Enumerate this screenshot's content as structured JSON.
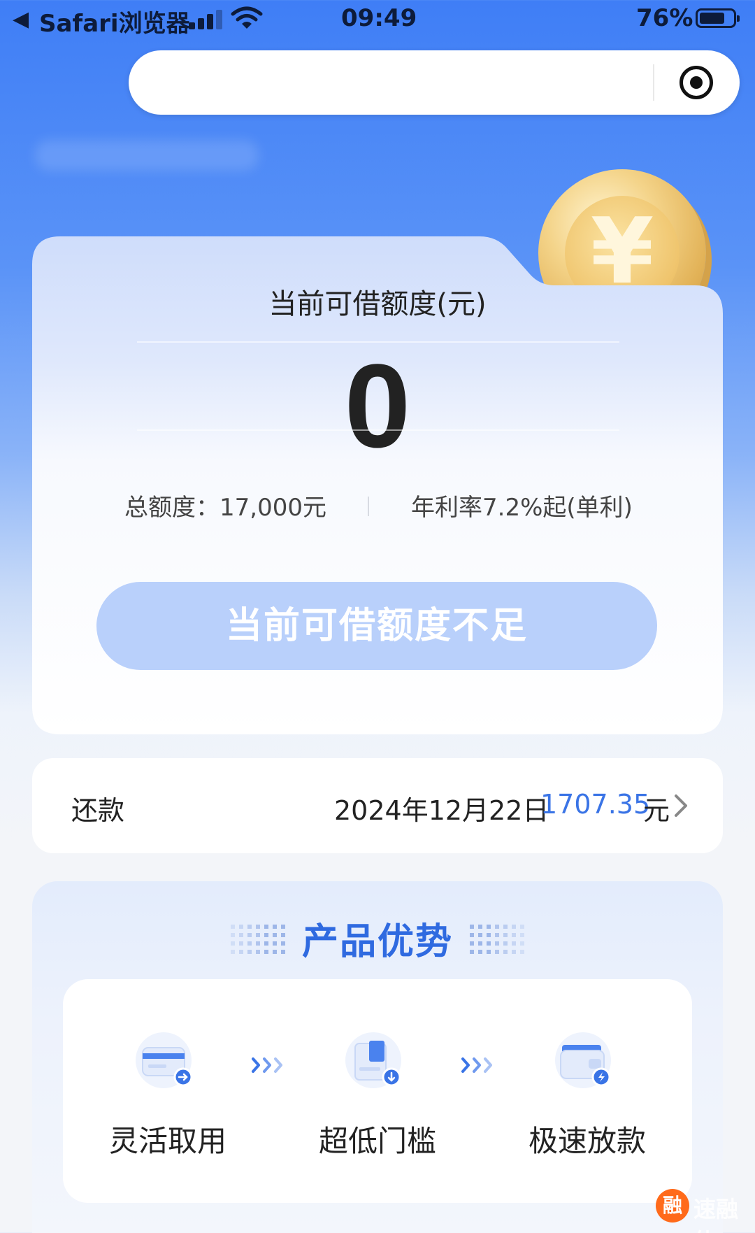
{
  "status_bar": {
    "back_glyph": "◀",
    "carrier": "Safari浏览器",
    "time": "09:49",
    "battery_percent": "76%",
    "battery_level": 0.76,
    "icons": [
      "back-arrow-icon",
      "signal-icon",
      "wifi-icon",
      "battery-icon"
    ]
  },
  "url_bar": {
    "url_text": "",
    "record_icon": "target-icon"
  },
  "quota_card": {
    "label": "当前可借额度(元)",
    "amount": "0",
    "total_quota": "总额度：17,000元",
    "annual_rate": "年利率7.2%起(单利)",
    "button_label": "当前可借额度不足",
    "coin_symbol": "¥"
  },
  "repay": {
    "title": "还款",
    "date": "2024年12月22日",
    "amount": "1707.35",
    "unit": "元"
  },
  "advantages": {
    "heading": "产品优势",
    "items": [
      {
        "label": "灵活取用",
        "icon": "card-icon"
      },
      {
        "label": "超低门槛",
        "icon": "document-icon"
      },
      {
        "label": "极速放款",
        "icon": "wallet-icon"
      }
    ]
  },
  "watermark": {
    "badge": "融",
    "text": "速融侠"
  },
  "colors": {
    "accent": "#2f6ae0",
    "amount_blue": "#3a74e6",
    "disabled_button": "#b9d0fb"
  }
}
